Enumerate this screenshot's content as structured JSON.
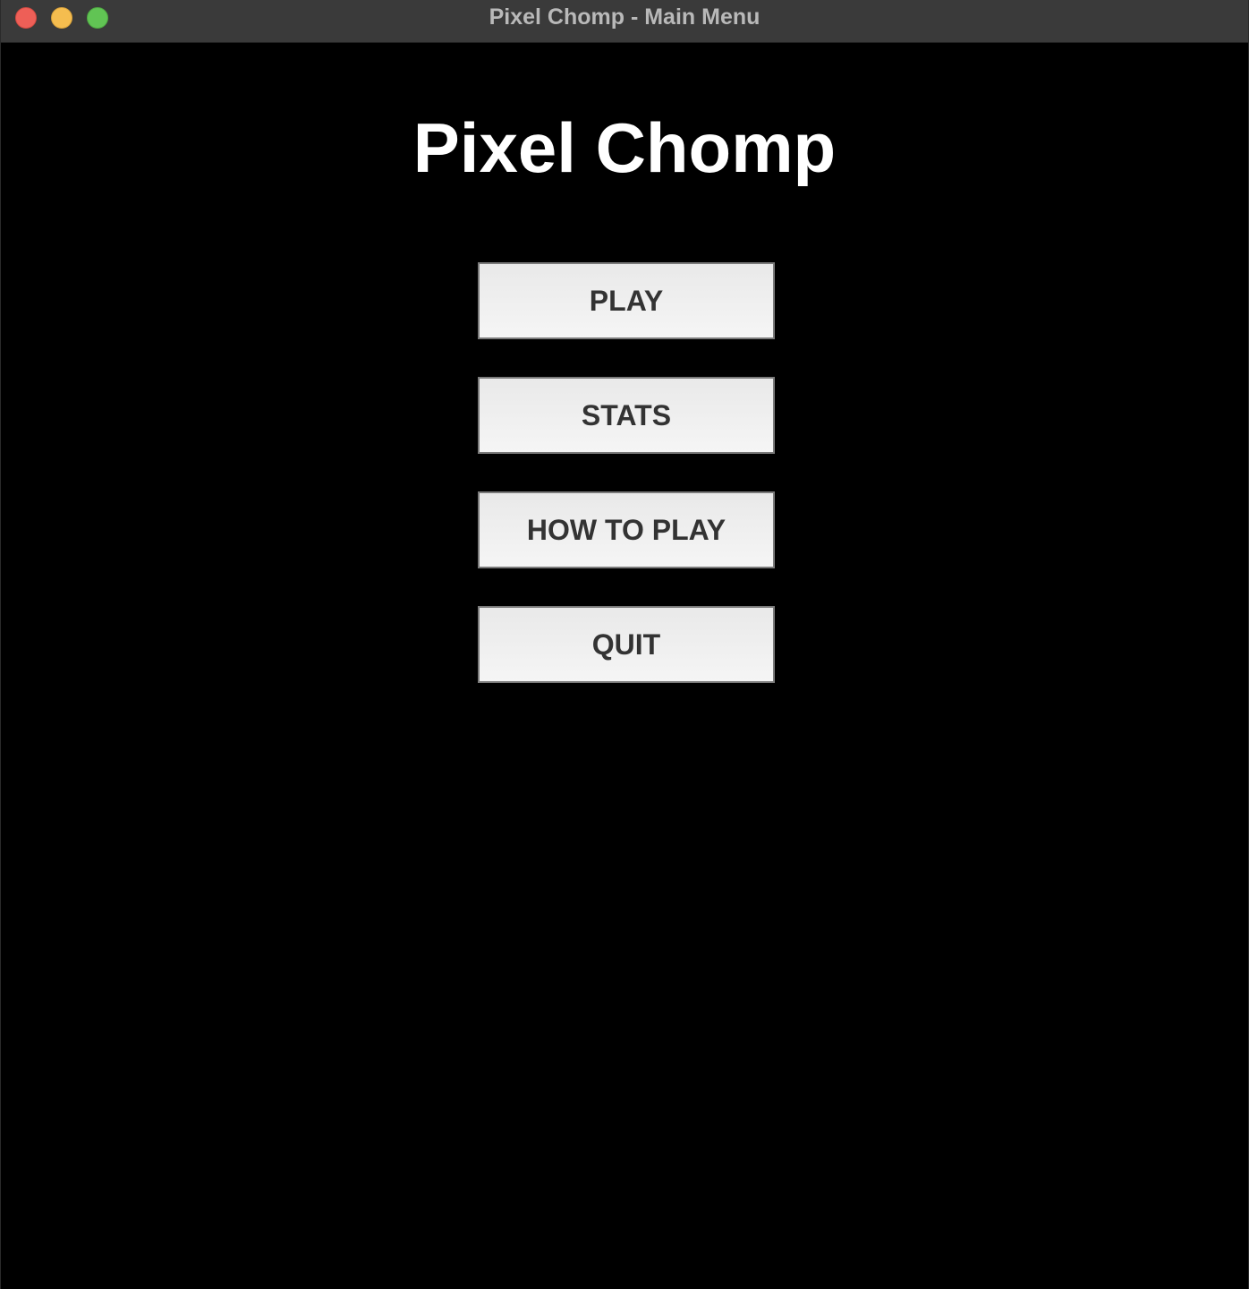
{
  "window": {
    "title": "Pixel Chomp - Main Menu",
    "controls": [
      "close-icon",
      "minimize-icon",
      "maximize-icon"
    ]
  },
  "main": {
    "game_title": "Pixel Chomp",
    "buttons": [
      {
        "label": "PLAY"
      },
      {
        "label": "STATS"
      },
      {
        "label": "HOW TO PLAY"
      },
      {
        "label": "QUIT"
      }
    ]
  },
  "colors": {
    "background": "#000000",
    "titlebar": "#3a3a3a",
    "title_text": "#ffffff",
    "button_bg": "#eeeeee",
    "button_text": "#333333",
    "close": "#ee5f57",
    "minimize": "#f5bd4f",
    "maximize": "#61c454"
  }
}
